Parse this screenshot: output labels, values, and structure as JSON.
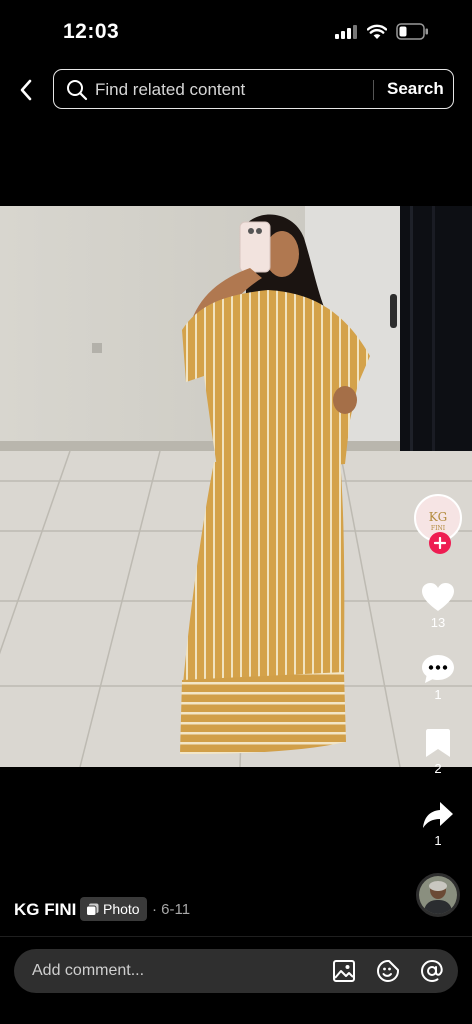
{
  "status_bar": {
    "time": "12:03"
  },
  "search": {
    "placeholder": "Find related content",
    "button_label": "Search"
  },
  "post": {
    "author": "KG FINI",
    "type_label": "Photo",
    "date": "· 6-11",
    "avatar_text": "KG FINI"
  },
  "actions": {
    "likes": "13",
    "comments": "1",
    "saves": "2",
    "shares": "1"
  },
  "comment_bar": {
    "placeholder": "Add comment..."
  },
  "colors": {
    "follow_plus": "#ee1d52",
    "outfit_mustard": "#d4a24a",
    "background": "#000000"
  }
}
